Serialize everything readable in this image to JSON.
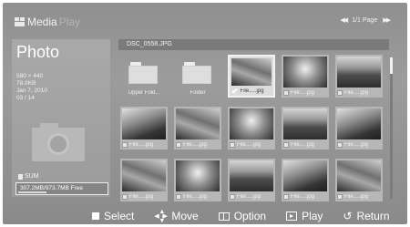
{
  "header": {
    "logo_primary": "Media",
    "logo_secondary": "Play",
    "page_indicator": "1/1 Page"
  },
  "sidebar": {
    "section_title": "Photo",
    "info": [
      "580 × 440",
      "78.0KB",
      "Jan 7, 2010",
      "03 / 14"
    ],
    "sum_label": "SUM",
    "storage": "307.2MB/973.7MB  Free",
    "storage_used_fraction": 0.32
  },
  "filename_bar": {
    "text": "DSC_0558.JPG"
  },
  "grid": {
    "items": [
      {
        "label": "Upper Fold...",
        "type": "folder"
      },
      {
        "label": "Folder",
        "type": "folder"
      },
      {
        "label": "File.....jpg",
        "type": "photo",
        "selected": true
      },
      {
        "label": "File.....jpg",
        "type": "photo"
      },
      {
        "label": "File.....jpg",
        "type": "photo"
      },
      {
        "label": "File.....jpg",
        "type": "photo"
      },
      {
        "label": "File.....jpg",
        "type": "photo"
      },
      {
        "label": "File.....jpg",
        "type": "photo"
      },
      {
        "label": "File.....jpg",
        "type": "photo"
      },
      {
        "label": "File.....jpg",
        "type": "photo"
      },
      {
        "label": "File.....jpg",
        "type": "photo"
      },
      {
        "label": "File.....jpg",
        "type": "photo"
      },
      {
        "label": "File.....jpg",
        "type": "photo"
      },
      {
        "label": "File.....jpg",
        "type": "photo"
      },
      {
        "label": "File.....jpg",
        "type": "photo"
      }
    ]
  },
  "bottom_bar": {
    "select": "Select",
    "move": "Move",
    "option": "Option",
    "play": "Play",
    "return": "Return"
  }
}
